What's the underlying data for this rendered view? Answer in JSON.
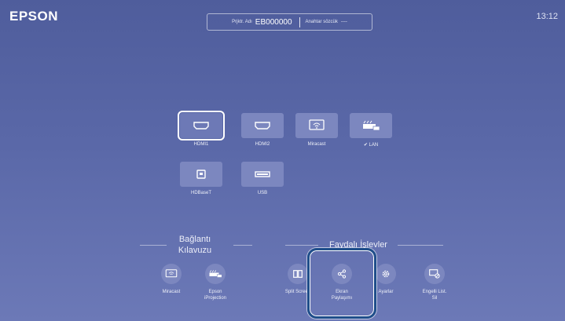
{
  "header": {
    "logo": "EPSON",
    "clock": "13:12",
    "projector_name_label": "Prjktr. Adı",
    "projector_name_value": "EB000000",
    "keyword_label": "Anahtar sözcük",
    "keyword_value": "----"
  },
  "sources": [
    {
      "label": "HDMI1",
      "icon": "hdmi-icon",
      "selected": true
    },
    {
      "label": "HDMI2",
      "icon": "hdmi-icon"
    },
    {
      "label": "Miracast",
      "icon": "miracast-icon"
    },
    {
      "label": "✔ LAN",
      "icon": "lan-icon"
    },
    {
      "label": "HDBaseT",
      "icon": "hdbaset-icon"
    },
    {
      "label": "USB",
      "icon": "usb-icon"
    }
  ],
  "connection_guide": {
    "title_line1": "Bağlantı",
    "title_line2": "Kılavuzu",
    "items": [
      {
        "label": "Miracast",
        "icon": "miracast-icon"
      },
      {
        "label_line1": "Epson",
        "label_line2": "iProjection",
        "icon": "iprojection-icon"
      }
    ]
  },
  "useful_functions": {
    "title": "Faydalı İşlevler",
    "items": [
      {
        "label": "Split Screen",
        "icon": "split-screen-icon"
      },
      {
        "label_line1": "Ekran",
        "label_line2": "Paylaşımı",
        "icon": "share-icon",
        "highlighted": true
      },
      {
        "label": "Ayarlar",
        "icon": "settings-icon"
      },
      {
        "label_line1": "Engelli List.",
        "label_line2": "Sil",
        "icon": "clear-blocked-list-icon"
      }
    ]
  },
  "colors": {
    "background": "#5a68a8",
    "tile": "#7c87bf",
    "highlight_border": "#1f4e8a"
  }
}
